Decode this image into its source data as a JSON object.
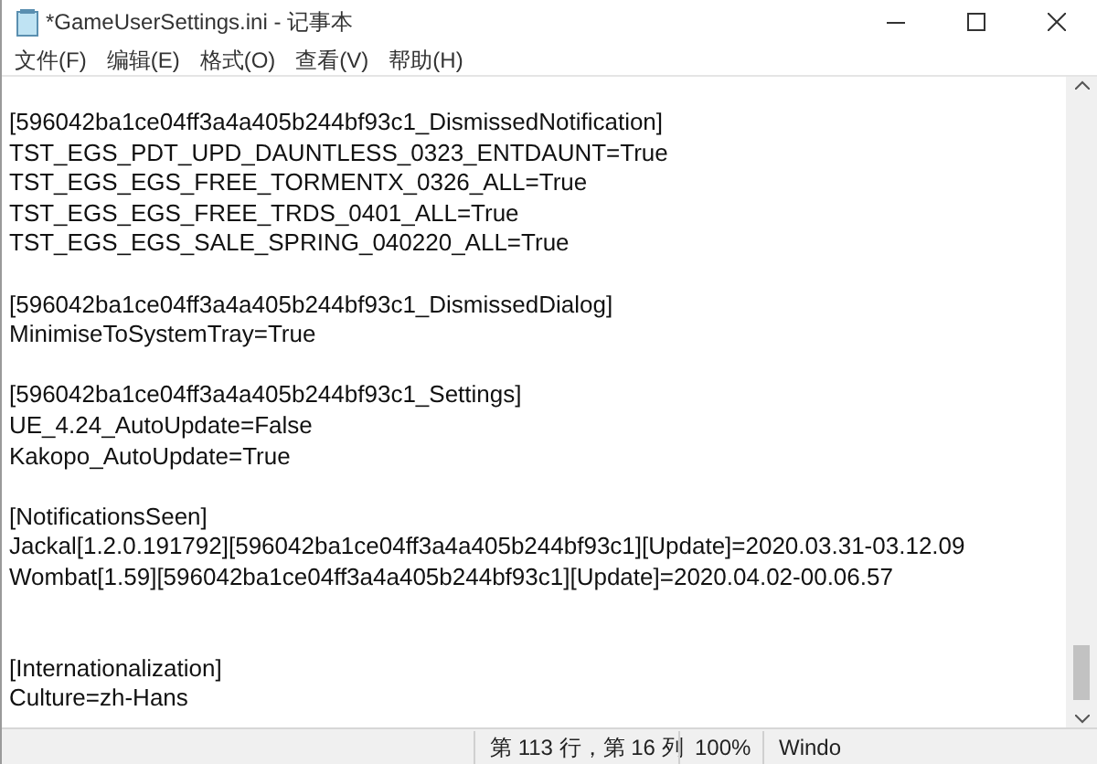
{
  "window": {
    "title": "*GameUserSettings.ini - 记事本"
  },
  "menu": [
    "文件(F)",
    "编辑(E)",
    "格式(O)",
    "查看(V)",
    "帮助(H)"
  ],
  "editor": {
    "lines": [
      {
        "kind": "text",
        "text": "[596042ba1ce04ff3a4a405b244bf93c1_DismissedNotification]"
      },
      {
        "kind": "text",
        "text": "TST_EGS_PDT_UPD_DAUNTLESS_0323_ENTDAUNT=True"
      },
      {
        "kind": "text",
        "text": "TST_EGS_EGS_FREE_TORMENTX_0326_ALL=True"
      },
      {
        "kind": "text",
        "text": "TST_EGS_EGS_FREE_TRDS_0401_ALL=True"
      },
      {
        "kind": "text",
        "text": "TST_EGS_EGS_SALE_SPRING_040220_ALL=True"
      },
      {
        "kind": "blank"
      },
      {
        "kind": "text",
        "text": "[596042ba1ce04ff3a4a405b244bf93c1_DismissedDialog]"
      },
      {
        "kind": "text",
        "text": "MinimiseToSystemTray=True"
      },
      {
        "kind": "blank"
      },
      {
        "kind": "text",
        "text": "[596042ba1ce04ff3a4a405b244bf93c1_Settings]"
      },
      {
        "kind": "text",
        "text": "UE_4.24_AutoUpdate=False"
      },
      {
        "kind": "text",
        "text": "Kakopo_AutoUpdate=True"
      },
      {
        "kind": "blank"
      },
      {
        "kind": "text",
        "text": "[NotificationsSeen]"
      },
      {
        "kind": "text",
        "text": "Jackal[1.2.0.191792][596042ba1ce04ff3a4a405b244bf93c1][Update]=2020.03.31-03.12.09"
      },
      {
        "kind": "text",
        "text": "Wombat[1.59][596042ba1ce04ff3a4a405b244bf93c1][Update]=2020.04.02-00.06.57"
      },
      {
        "kind": "blank"
      },
      {
        "kind": "blank"
      },
      {
        "kind": "text",
        "text": "[Internationalization]"
      },
      {
        "kind": "text",
        "text": "Culture=zh-Hans"
      }
    ]
  },
  "status_bar": {
    "position": "第 113 行，第 16 列",
    "zoom": "100%",
    "line_ending": "Windo"
  }
}
